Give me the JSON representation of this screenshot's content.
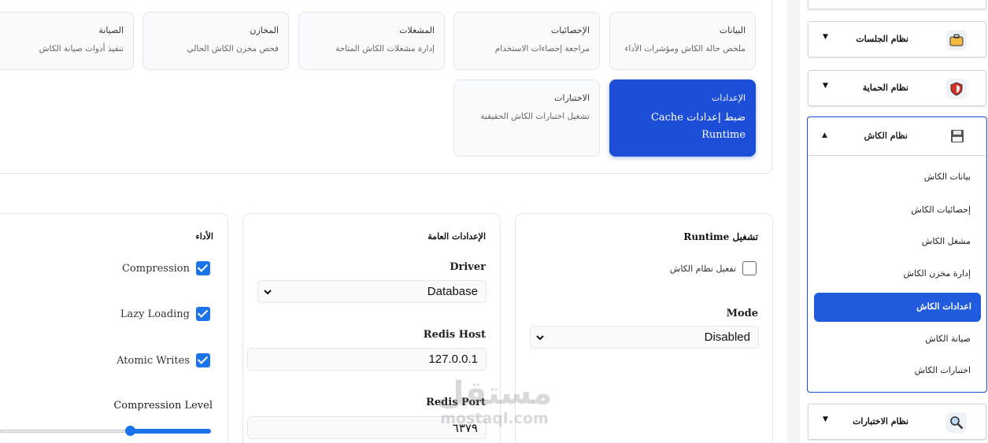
{
  "nav_cards": [
    {
      "title": "البيانات",
      "desc": "ملخص حالة الكاش ومؤشرات الأداء"
    },
    {
      "title": "الإحصائيات",
      "desc": "مراجعة إحصاءات الاستخدام"
    },
    {
      "title": "المشغلات",
      "desc": "إدارة مشغلات الكاش المتاحة"
    },
    {
      "title": "المخازن",
      "desc": "فحص مخزن الكاش الحالي"
    },
    {
      "title": "الصيانة",
      "desc": "تنفيذ أدوات صيانة الكاش"
    },
    {
      "title": "الإعدادات",
      "desc": "ضبط إعدادات Cache Runtime"
    },
    {
      "title": "الاختبارات",
      "desc": "تشغيل اختبارات الكاش الحقيقية"
    }
  ],
  "runtime_card": {
    "title": "تشغيل Runtime",
    "enable_label": "تفعيل نظام الكاش",
    "enable_checked": false,
    "mode_label": "Mode",
    "mode_value": "Disabled"
  },
  "general_card": {
    "title": "الإعدادات العامة",
    "driver_label": "Driver",
    "driver_value": "Database",
    "redis_host_label": "Redis Host",
    "redis_host_value": "127.0.0.1",
    "redis_port_label": "Redis Port",
    "redis_port_value": "٦٣٧٩"
  },
  "performance_card": {
    "title": "الأداء",
    "compression_label": "Compression",
    "lazy_loading_label": "Lazy Loading",
    "atomic_writes_label": "Atomic Writes",
    "compression_level_label": "Compression Level",
    "compression_level_fraction": 0.6
  },
  "sidebar": {
    "sessions": {
      "label": "نظام الجلسات",
      "icon": "briefcase-icon"
    },
    "security": {
      "label": "نظام الحماية",
      "icon": "shield-icon"
    },
    "cache": {
      "label": "نظام الكاش",
      "icon": "floppy-disk-icon"
    },
    "cache_items": [
      "بيانات الكاش",
      "إحصائيات الكاش",
      "مشغل الكاش",
      "إدارة مخزن الكاش",
      "اعدادات الكاش",
      "صيانة الكاش",
      "اختبارات الكاش"
    ],
    "tests": {
      "label": "نظام الاختبارات",
      "icon": "search-icon"
    }
  },
  "watermark": {
    "arabic": "مستقل",
    "latin": "mostaql.com"
  },
  "colors": {
    "accent": "#1d4ed8",
    "checkbox": "#1a73e8"
  }
}
